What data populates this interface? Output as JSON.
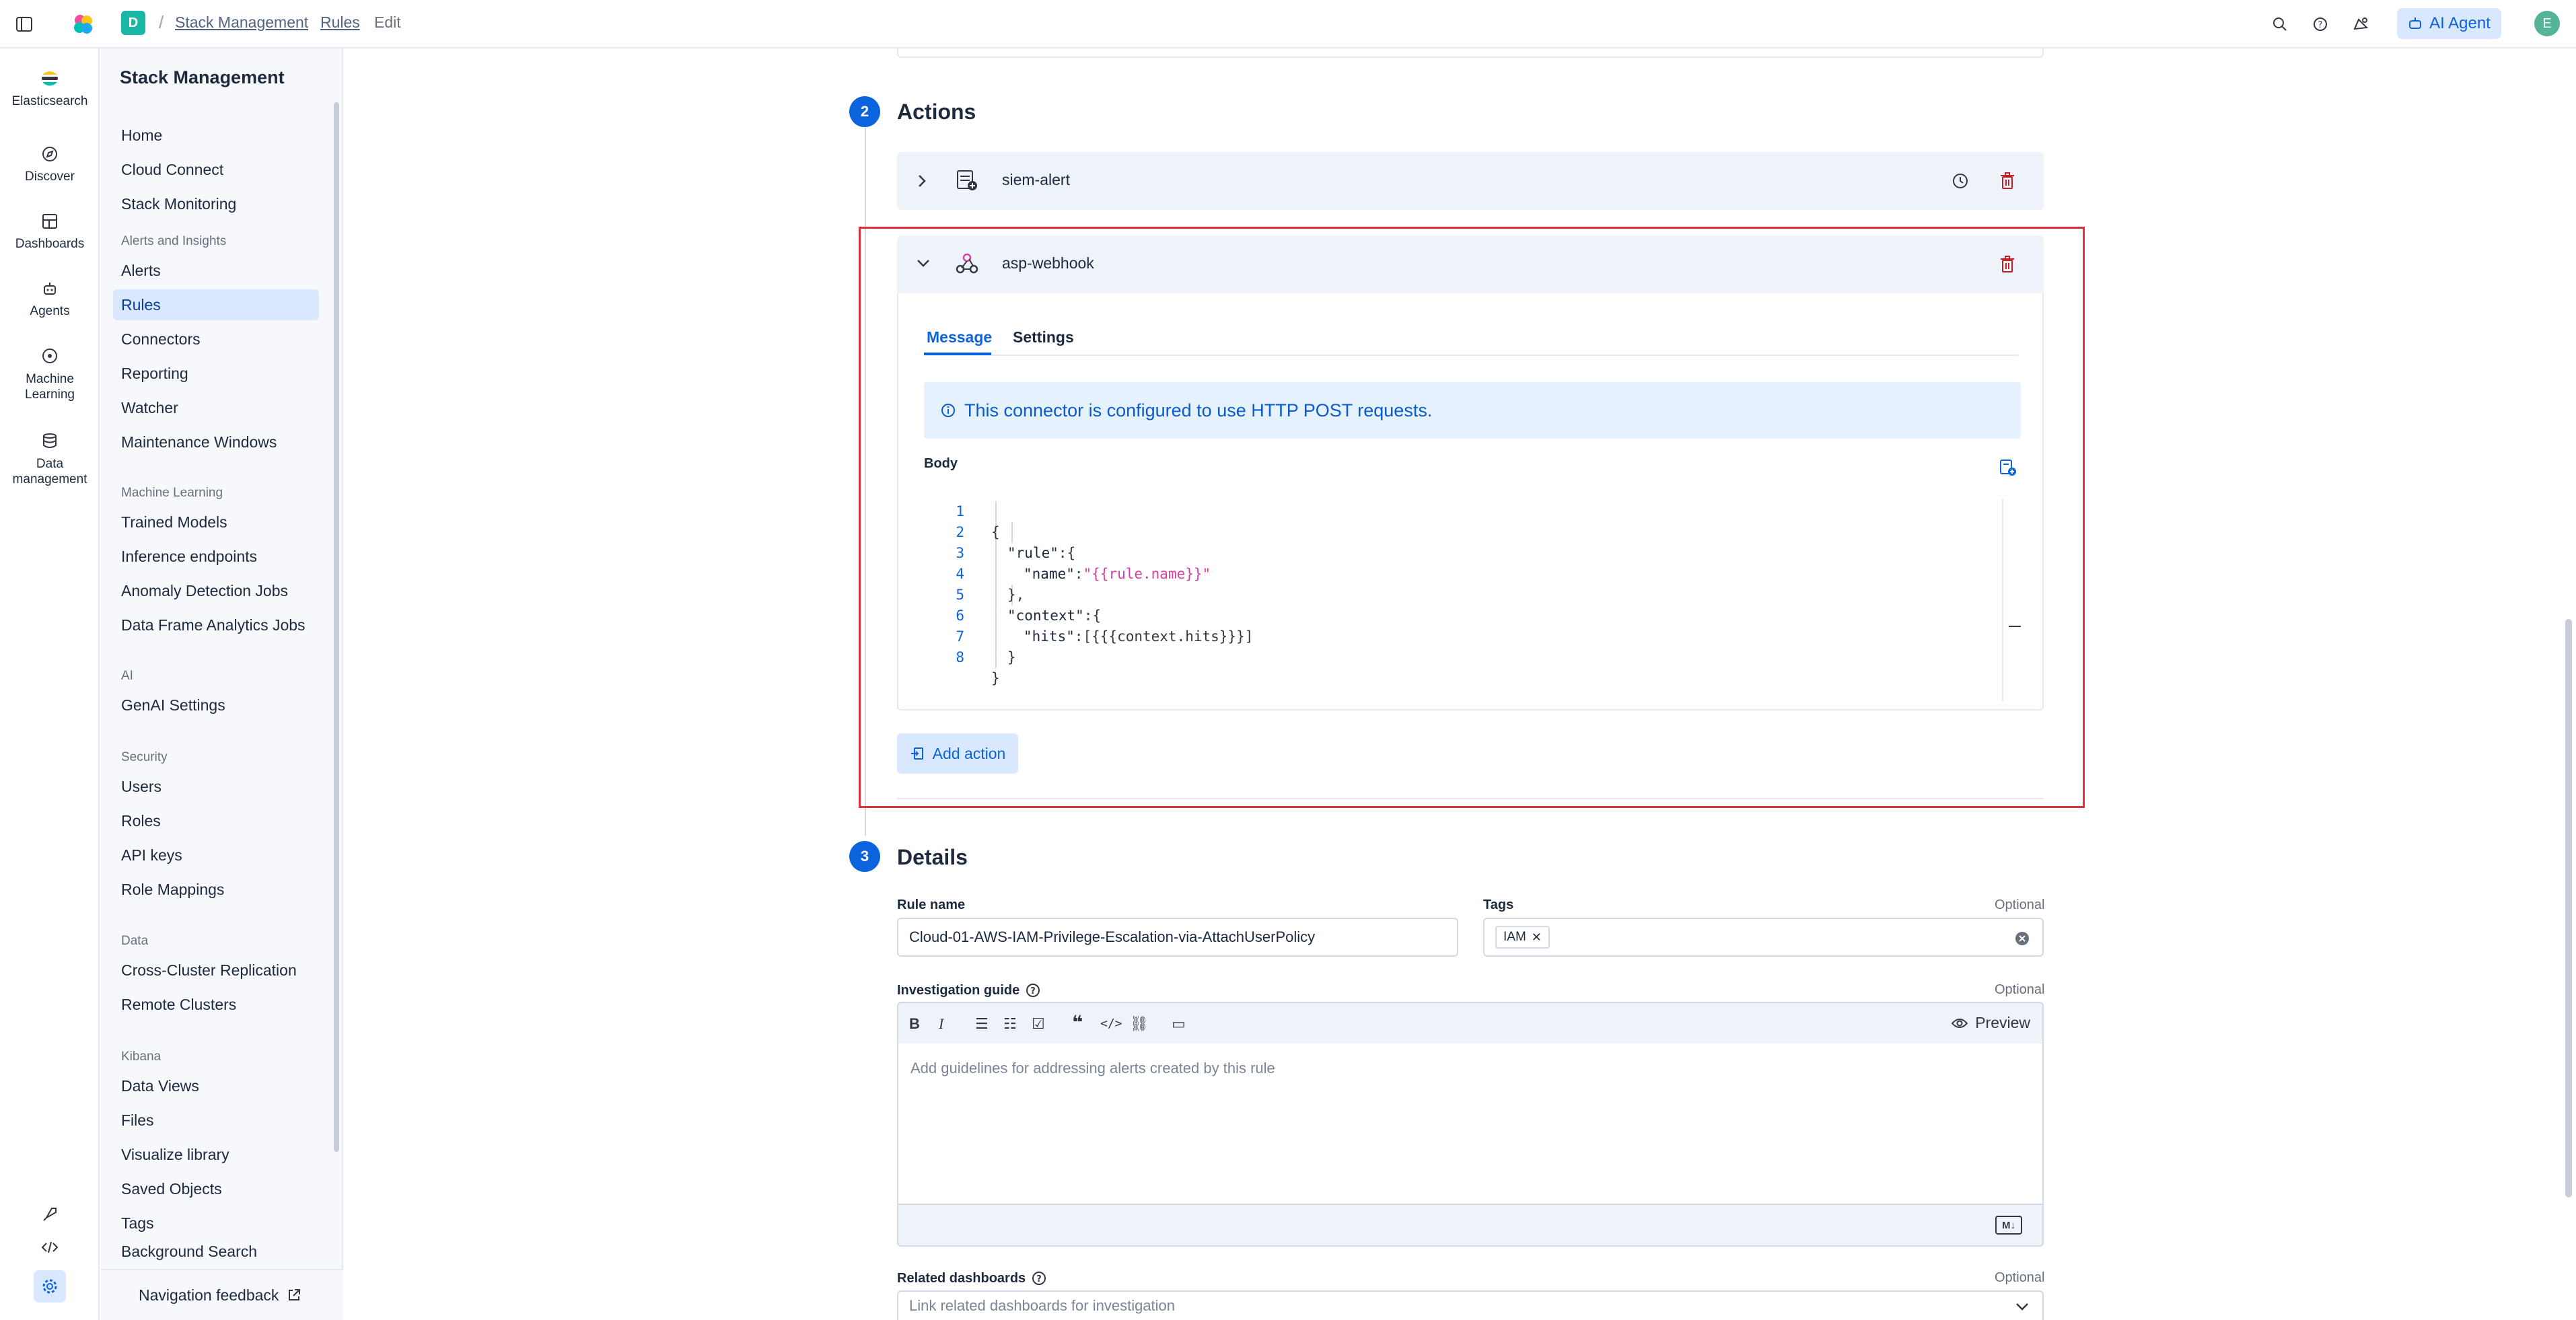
{
  "header": {
    "space_letter": "D",
    "breadcrumbs": [
      "Stack Management",
      "Rules",
      "Edit"
    ],
    "ai_agent_label": "AI Agent",
    "avatar_letter": "E"
  },
  "rail": {
    "brand": "Elasticsearch",
    "items": [
      {
        "label": "Discover",
        "icon": "compass-icon"
      },
      {
        "label": "Dashboards",
        "icon": "dashboard-icon"
      },
      {
        "label": "Agents",
        "icon": "robot-icon"
      },
      {
        "label": "Machine\nLearning",
        "icon": "ml-icon"
      },
      {
        "label": "Data\nmanagement",
        "icon": "database-icon"
      }
    ]
  },
  "subnav": {
    "title": "Stack Management",
    "top_items": [
      "Home",
      "Cloud Connect",
      "Stack Monitoring"
    ],
    "groups": [
      {
        "name": "Alerts and Insights",
        "items": [
          "Alerts",
          "Rules",
          "Connectors",
          "Reporting",
          "Watcher",
          "Maintenance Windows"
        ]
      },
      {
        "name": "Machine Learning",
        "items": [
          "Trained Models",
          "Inference endpoints",
          "Anomaly Detection Jobs",
          "Data Frame Analytics Jobs"
        ]
      },
      {
        "name": "AI",
        "items": [
          "GenAI Settings"
        ]
      },
      {
        "name": "Security",
        "items": [
          "Users",
          "Roles",
          "API keys",
          "Role Mappings"
        ]
      },
      {
        "name": "Data",
        "items": [
          "Cross-Cluster Replication",
          "Remote Clusters"
        ]
      },
      {
        "name": "Kibana",
        "items": [
          "Data Views",
          "Files",
          "Visualize library",
          "Saved Objects",
          "Tags",
          "Background Search"
        ]
      }
    ],
    "active_item": "Rules",
    "feedback_label": "Navigation feedback"
  },
  "actions_step": {
    "number": "2",
    "title": "Actions",
    "collapsed_action": "siem-alert",
    "expanded_action": "asp-webhook",
    "tabs": [
      "Message",
      "Settings"
    ],
    "callout": "This connector is configured to use HTTP POST requests.",
    "body_label": "Body",
    "code_lines": [
      {
        "n": "1",
        "indent": 0,
        "key": "",
        "val": "",
        "raw": "{"
      },
      {
        "n": "2",
        "indent": 1,
        "key": "\"rule\"",
        "val": "",
        "raw": ":{"
      },
      {
        "n": "3",
        "indent": 2,
        "key": "\"name\"",
        "val": "\"{{rule.name}}\"",
        "raw": ":"
      },
      {
        "n": "4",
        "indent": 1,
        "key": "",
        "val": "",
        "raw": "},"
      },
      {
        "n": "5",
        "indent": 1,
        "key": "\"context\"",
        "val": "",
        "raw": ":{"
      },
      {
        "n": "6",
        "indent": 2,
        "key": "\"hits\"",
        "val": "",
        "raw": ":[{{{context.hits}}}]"
      },
      {
        "n": "7",
        "indent": 1,
        "key": "",
        "val": "",
        "raw": "}"
      },
      {
        "n": "8",
        "indent": 0,
        "key": "",
        "val": "",
        "raw": "}"
      }
    ],
    "add_action_label": "Add action"
  },
  "details_step": {
    "number": "3",
    "title": "Details",
    "rule_name_label": "Rule name",
    "rule_name_value": "Cloud-01-AWS-IAM-Privilege-Escalation-via-AttachUserPolicy",
    "tags_label": "Tags",
    "optional_label": "Optional",
    "tags": [
      "IAM"
    ],
    "guide_label": "Investigation guide",
    "preview_label": "Preview",
    "guide_placeholder": "Add guidelines for addressing alerts created by this rule",
    "related_label": "Related dashboards",
    "related_placeholder": "Link related dashboards for investigation",
    "md_badge": "M↓"
  },
  "colors": {
    "accent": "#0b64dd",
    "highlight_border": "#e0303b",
    "danger": "#c61e25"
  }
}
